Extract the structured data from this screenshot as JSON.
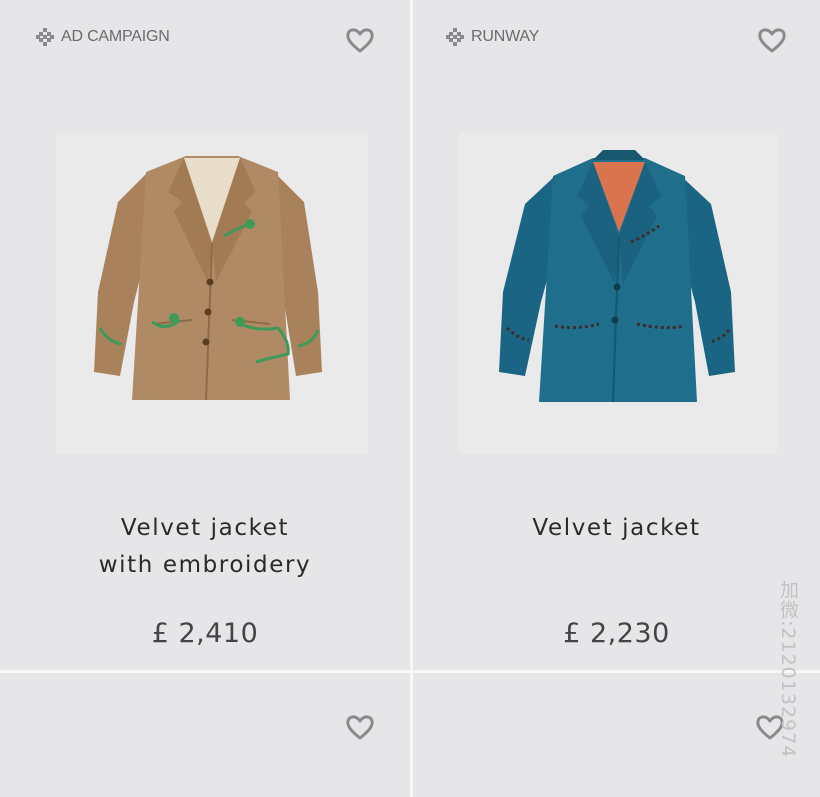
{
  "products": [
    {
      "tag": "AD CAMPAIGN",
      "name": "Velvet jacket with embroidery",
      "price": "£ 2,410",
      "image": "beige-velvet-jacket-with-green-embroidery",
      "colors": {
        "body": "#b08a64",
        "lining": "#e8ddc9",
        "embroidery": "#3f9a5a"
      }
    },
    {
      "tag": "RUNWAY",
      "name": "Velvet jacket",
      "price": "£ 2,230",
      "image": "teal-velvet-jacket-with-orange-lining",
      "colors": {
        "body": "#1f6f8c",
        "lining": "#d9744f",
        "embroidery": "#3a2f2a"
      }
    }
  ],
  "next_row": {
    "favorite_icon": "heart-outline-icon"
  },
  "watermark": "加微:2120132974",
  "theme": {
    "background": "#e6e6e8",
    "divider": "#f7f7f8",
    "icon_gray": "#8a8a8c"
  }
}
